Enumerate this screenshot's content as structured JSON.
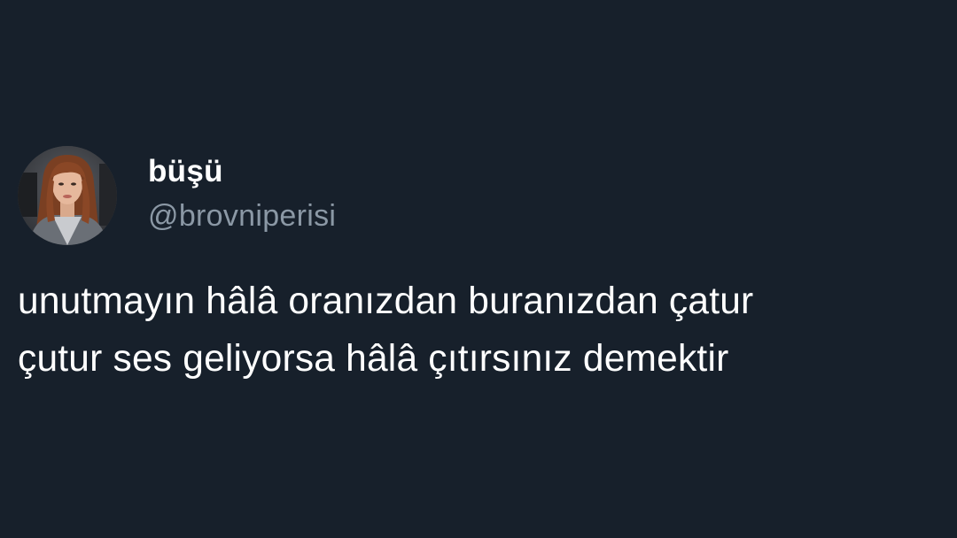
{
  "user": {
    "display_name": "büşü",
    "handle": "@brovniperisi"
  },
  "tweet": {
    "lines": [
      "unutmayın hâlâ oranızdan buranızdan çatur",
      "çutur ses geliyorsa hâlâ çıtırsınız demektir"
    ]
  },
  "colors": {
    "background": "#17202b",
    "text": "#ffffff",
    "handle": "#8b98a5"
  }
}
